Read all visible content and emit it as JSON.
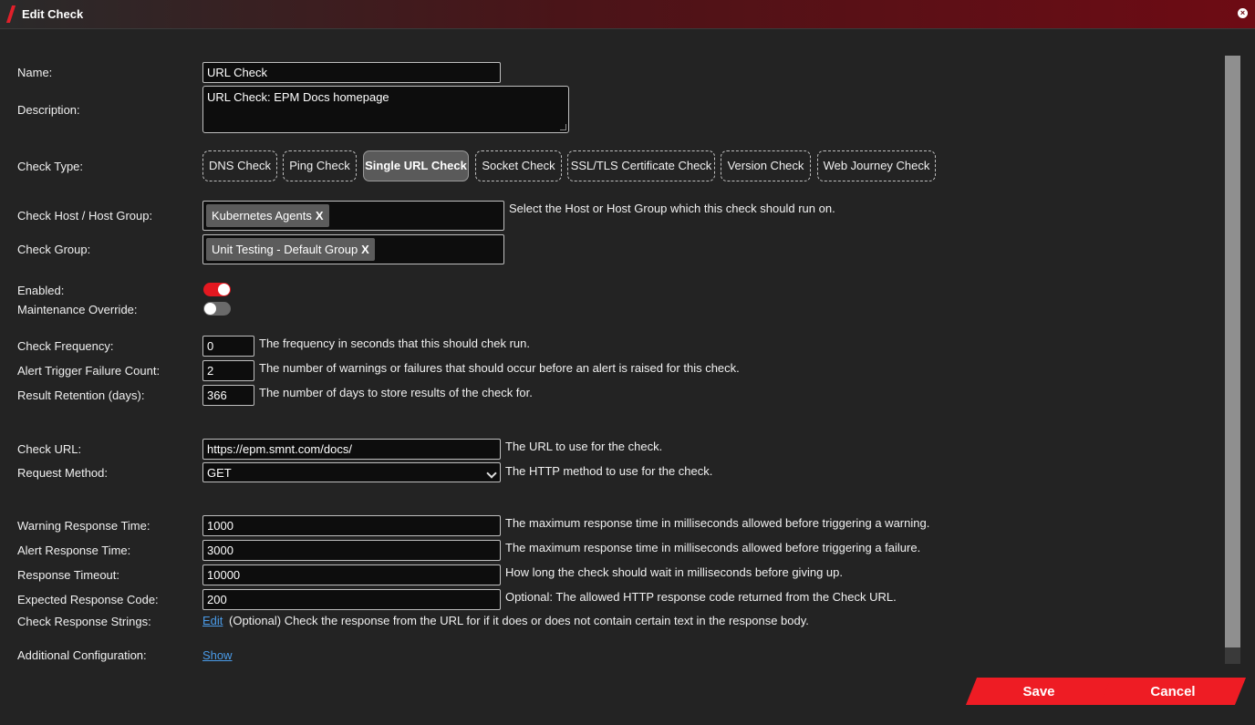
{
  "dialog": {
    "title": "Edit Check",
    "close_icon": "×"
  },
  "form": {
    "name_label": "Name:",
    "name_value": "URL Check",
    "description_label": "Description:",
    "description_value": "URL Check: EPM Docs homepage",
    "check_type_label": "Check Type:",
    "check_types": [
      {
        "label": "DNS Check",
        "active": false
      },
      {
        "label": "Ping Check",
        "active": false
      },
      {
        "label": "Single URL Check",
        "active": true
      },
      {
        "label": "Socket Check",
        "active": false
      },
      {
        "label": "SSL/TLS Certificate Check",
        "active": false
      },
      {
        "label": "Version Check",
        "active": false
      },
      {
        "label": "Web Journey Check",
        "active": false
      }
    ],
    "host_label": "Check Host / Host Group:",
    "host_tag": "Kubernetes Agents",
    "tag_remove": "X",
    "host_help": "Select the Host or Host Group which this check should run on.",
    "group_label": "Check Group:",
    "group_tag": "Unit Testing - Default Group",
    "enabled_label": "Enabled:",
    "enabled": true,
    "maintenance_label": "Maintenance Override:",
    "maintenance": false,
    "frequency_label": "Check Frequency:",
    "frequency_value": "0",
    "frequency_help": "The frequency in seconds that this should chek run.",
    "alert_count_label": "Alert Trigger Failure Count:",
    "alert_count_value": "2",
    "alert_count_help": "The number of warnings or failures that should occur before an alert is raised for this check.",
    "retention_label": "Result Retention (days):",
    "retention_value": "366",
    "retention_help": "The number of days to store results of the check for.",
    "url_label": "Check URL:",
    "url_value": "https://epm.smnt.com/docs/",
    "url_help": "The URL to use for the check.",
    "method_label": "Request Method:",
    "method_value": "GET",
    "method_help": "The HTTP method to use for the check.",
    "warning_time_label": "Warning Response Time:",
    "warning_time_value": "1000",
    "warning_time_help": "The maximum response time in milliseconds allowed before triggering a warning.",
    "alert_time_label": "Alert Response Time:",
    "alert_time_value": "3000",
    "alert_time_help": "The maximum response time in milliseconds allowed before triggering a failure.",
    "timeout_label": "Response Timeout:",
    "timeout_value": "10000",
    "timeout_help": "How long the check should wait in milliseconds before giving up.",
    "expected_code_label": "Expected Response Code:",
    "expected_code_value": "200",
    "expected_code_help": "Optional: The allowed HTTP response code returned from the Check URL.",
    "response_strings_label": "Check Response Strings:",
    "response_strings_link": "Edit",
    "response_strings_help": "(Optional) Check the response from the URL for if it does or does not contain certain text in the response body.",
    "additional_label": "Additional Configuration:",
    "additional_link": "Show"
  },
  "actions": {
    "save_label": "Save",
    "cancel_label": "Cancel"
  },
  "colors": {
    "accent": "#ee1c24",
    "link": "#4a9be8",
    "background": "#232323"
  }
}
